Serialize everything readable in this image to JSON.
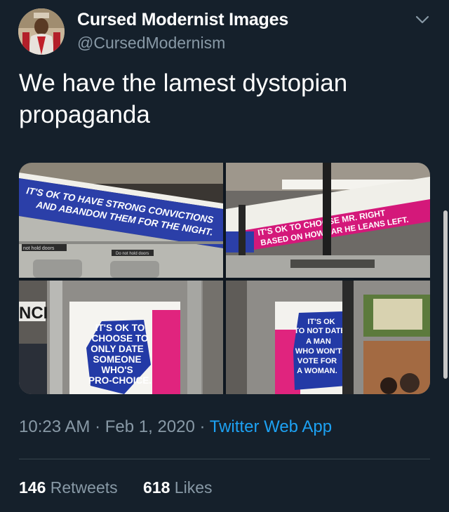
{
  "tweet": {
    "display_name": "Cursed Modernist Images",
    "handle": "@CursedModernism",
    "text": "We have the lamest dystopian propaganda",
    "time": "10:23 AM",
    "date": "Feb 1, 2020",
    "source": "Twitter Web App",
    "separator": "·"
  },
  "stats": {
    "retweets_count": "146",
    "retweets_label": "Retweets",
    "likes_count": "618",
    "likes_label": "Likes"
  },
  "media": {
    "panel1": {
      "line1": "IT'S OK TO HAVE STRONG CONVICTIONS",
      "line2": "AND ABANDON THEM FOR THE NIGHT.",
      "sticker1": "not hold doors",
      "sticker2": "Do not hold doors"
    },
    "panel2": {
      "line1": "IT'S OK TO CHOOSE MR. RIGHT",
      "line2": "BASED ON HOW FAR HE LEANS LEFT."
    },
    "panel3": {
      "lines": [
        "IT'S OK TO",
        "CHOOSE TO",
        "ONLY DATE",
        "SOMEONE",
        "WHO'S",
        "PRO-CHOICE."
      ],
      "station_text": "NCI"
    },
    "panel4": {
      "lines": [
        "IT'S OK",
        "TO NOT DATE",
        "A MAN",
        "WHO WON'T",
        "VOTE FOR",
        "A WOMAN."
      ]
    }
  },
  "colors": {
    "background": "#15202b",
    "secondary_text": "#8899a6",
    "link": "#1da1f2",
    "ad_blue": "#2b3fa8",
    "ad_magenta": "#d4187a"
  },
  "icons": {
    "caret": "chevron-down-icon"
  }
}
